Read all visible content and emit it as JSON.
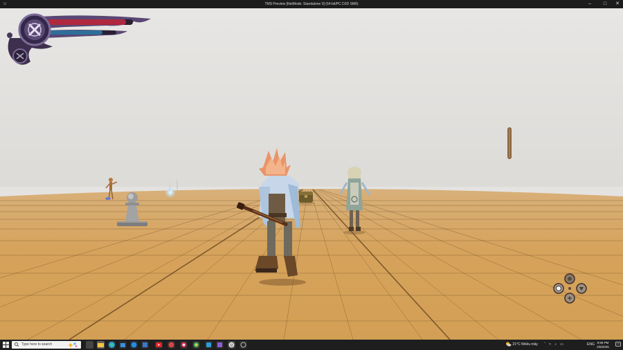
{
  "window": {
    "title": "TMS Preview [NetMode: Standalone 0] (64-bit/PC D3D SM6)",
    "app_icon": "U",
    "controls": [
      "minimize-icon",
      "maximize-icon",
      "close-icon"
    ]
  },
  "hud": {
    "health_fraction": 0.92,
    "mana_fraction": 0.8,
    "health_color": "#b0283e",
    "mana_color": "#2e6f99",
    "frame_color": "#4b3a5e"
  },
  "scene": {
    "sky_color": "#e4e3e1",
    "floor_color": "#d7a55e",
    "grid_line_color": "#4a2f12"
  },
  "taskbar": {
    "search_placeholder": "Type here to search",
    "apps": [
      "file-explorer-icon",
      "edge-icon",
      "store-icon",
      "mail-icon",
      "photos-icon",
      "youtube-icon",
      "discord-icon",
      "chrome-icon",
      "steam-icon",
      "visual-studio-icon",
      "unreal-engine-icon",
      "terminal-icon"
    ],
    "weather": "21°C  Nhiều mây",
    "language": "ENG",
    "time": "8:59 PM",
    "date": "2/5/2025"
  }
}
